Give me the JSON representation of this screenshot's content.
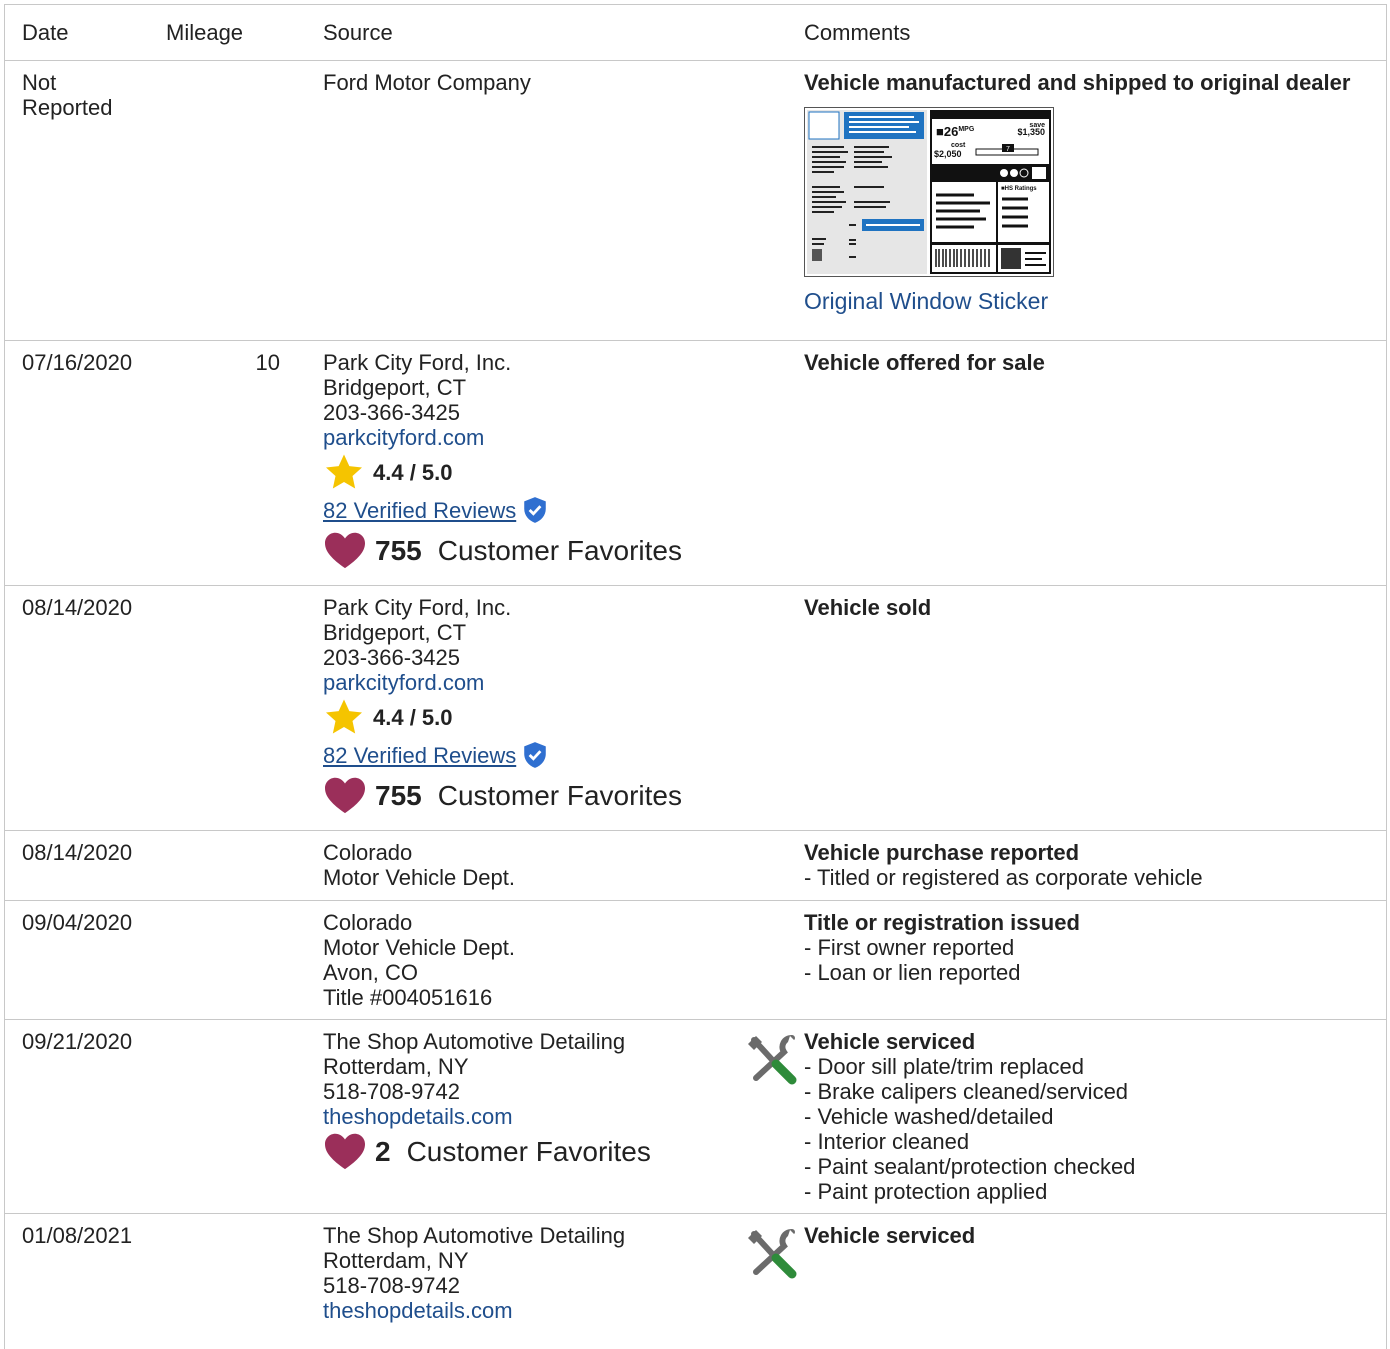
{
  "headers": {
    "date": "Date",
    "mileage": "Mileage",
    "source": "Source",
    "comments": "Comments"
  },
  "sticker": {
    "mpg": "26",
    "mpg_unit": "MPG",
    "you_save_label": "save",
    "you_save": "$1,350",
    "cost_label": "cost",
    "fuel_cost": "$2,050",
    "ratings_label": "HS Ratings",
    "score": "7",
    "link": "Original Window Sticker"
  },
  "rows": [
    {
      "date": "Not",
      "date2": "Reported",
      "source": [
        "Ford Motor Company"
      ],
      "comment_title": "Vehicle manufactured and shipped to original dealer"
    },
    {
      "date": "07/16/2020",
      "mileage": "10",
      "source": [
        "Park City Ford, Inc.",
        "Bridgeport, CT",
        "203-366-3425"
      ],
      "website": "parkcityford.com",
      "rating": "4.4 / 5.0",
      "reviews": "82 Verified Reviews",
      "favorites": "755",
      "favorites_label": "Customer Favorites",
      "comment_title": "Vehicle offered for sale"
    },
    {
      "date": "08/14/2020",
      "source": [
        "Park City Ford, Inc.",
        "Bridgeport, CT",
        "203-366-3425"
      ],
      "website": "parkcityford.com",
      "rating": "4.4 / 5.0",
      "reviews": "82 Verified Reviews",
      "favorites": "755",
      "favorites_label": "Customer Favorites",
      "comment_title": "Vehicle sold"
    },
    {
      "date": "08/14/2020",
      "source": [
        "Colorado",
        "Motor Vehicle Dept."
      ],
      "comment_title": "Vehicle purchase reported",
      "comments": [
        "- Titled or registered as corporate vehicle"
      ]
    },
    {
      "date": "09/04/2020",
      "source": [
        "Colorado",
        "Motor Vehicle Dept.",
        "Avon, CO",
        "Title #004051616"
      ],
      "comment_title": "Title or registration issued",
      "comments": [
        "- First owner reported",
        "- Loan or lien reported"
      ]
    },
    {
      "date": "09/21/2020",
      "source": [
        "The Shop Automotive Detailing",
        "Rotterdam, NY",
        "518-708-9742"
      ],
      "website": "theshopdetails.com",
      "favorites": "2",
      "favorites_label": "Customer Favorites",
      "comment_title": "Vehicle serviced",
      "comments": [
        "- Door sill plate/trim replaced",
        "- Brake calipers cleaned/serviced",
        "- Vehicle washed/detailed",
        "- Interior cleaned",
        "- Paint sealant/protection checked",
        "- Paint protection applied"
      ]
    },
    {
      "date": "01/08/2021",
      "source": [
        "The Shop Automotive Detailing",
        "Rotterdam, NY",
        "518-708-9742"
      ],
      "website": "theshopdetails.com",
      "comment_title": "Vehicle serviced"
    }
  ],
  "colors": {
    "link": "#1f4e8c",
    "star": "#f5c400",
    "heart": "#9b2f5a",
    "check": "#2f6fd0",
    "tool_green": "#2e8b3a",
    "sticker_blue": "#1f73c1"
  }
}
